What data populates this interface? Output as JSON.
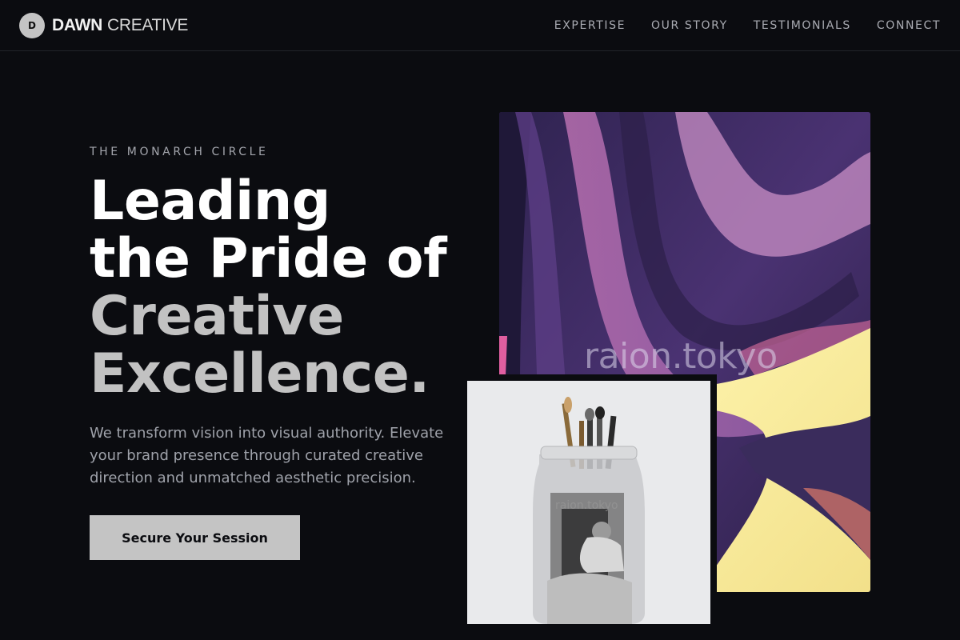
{
  "brand": {
    "badge_letter": "D",
    "name_strong": "DAWN",
    "name_light": "CREATIVE"
  },
  "nav": {
    "links": [
      "EXPERTISE",
      "OUR STORY",
      "TESTIMONIALS",
      "CONNECT"
    ]
  },
  "hero": {
    "eyebrow": "THE MONARCH CIRCLE",
    "headline_lines": [
      "Leading",
      "the Pride of",
      "Creative",
      "Excellence."
    ],
    "lead": "We transform vision into visual authority. Elevate your brand presence through curated creative direction and unmatched aesthetic precision.",
    "cta_label": "Secure Your Session"
  },
  "art": {
    "main_watermark": "raion.tokyo",
    "photo_watermark": "raion.tokyo",
    "main_image_icon": "abstract-purple-brushstroke-image",
    "photo_image_icon": "paintbrush-jar-photo"
  },
  "colors": {
    "background": "#0b0c10",
    "text_primary": "#ffffff",
    "text_secondary": "#c2c2c2",
    "text_muted": "#9fa2aa",
    "button": "#c4c4c4",
    "art_purple": "#3b2a63",
    "art_yellow": "#f6ec9a"
  }
}
